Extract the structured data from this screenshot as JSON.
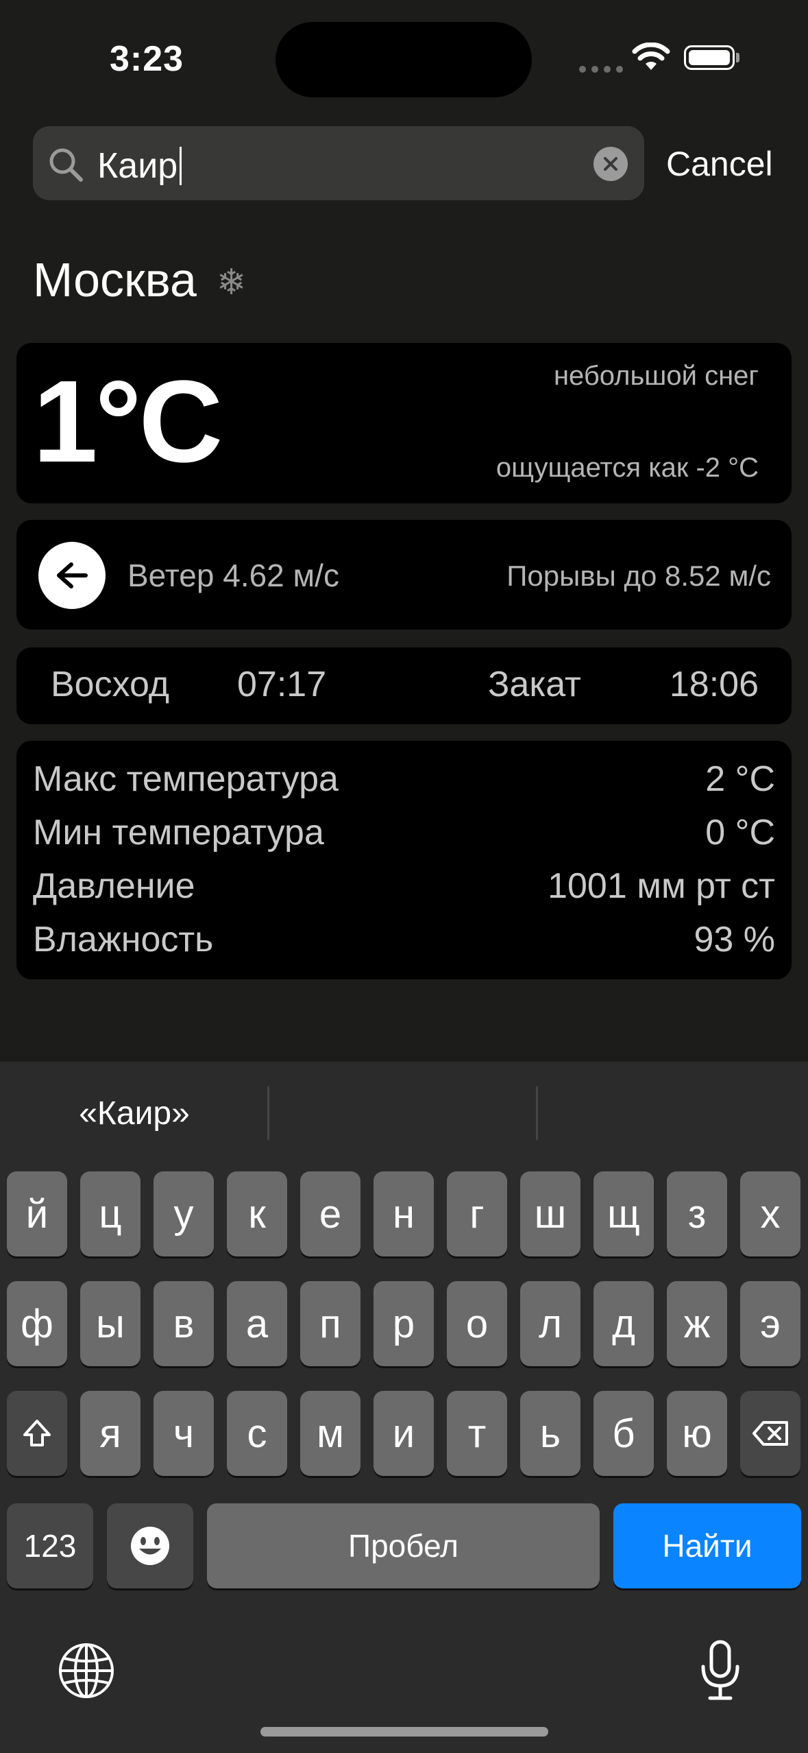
{
  "status_bar": {
    "time": "3:23"
  },
  "search": {
    "value": "Каир",
    "cancel_label": "Cancel"
  },
  "city": {
    "name": "Москва",
    "weather_icon": "snowflake-icon"
  },
  "current": {
    "temperature": "1°C",
    "description": "небольшой снег",
    "feels_like": "ощущается как -2 °C"
  },
  "wind": {
    "icon": "arrow-left-icon",
    "speed": "Ветер 4.62 м/с",
    "gusts": "Порывы до 8.52 м/с"
  },
  "sun": {
    "sunrise_label": "Восход",
    "sunrise_time": "07:17",
    "sunset_label": "Закат",
    "sunset_time": "18:06"
  },
  "stats": [
    {
      "label": "Макс температура",
      "value": "2 °C"
    },
    {
      "label": "Мин температура",
      "value": "0 °C"
    },
    {
      "label": "Давление",
      "value": "1001 мм рт ст"
    },
    {
      "label": "Влажность",
      "value": "93 %"
    }
  ],
  "keyboard": {
    "suggestion": "«Каир»",
    "row1": [
      "й",
      "ц",
      "у",
      "к",
      "е",
      "н",
      "г",
      "ш",
      "щ",
      "з",
      "х"
    ],
    "row2": [
      "ф",
      "ы",
      "в",
      "а",
      "п",
      "р",
      "о",
      "л",
      "д",
      "ж",
      "э"
    ],
    "row3": [
      "я",
      "ч",
      "с",
      "м",
      "и",
      "т",
      "ь",
      "б",
      "ю"
    ],
    "numbers_label": "123",
    "space_label": "Пробел",
    "return_label": "Найти",
    "accent_color": "#0a84ff"
  }
}
